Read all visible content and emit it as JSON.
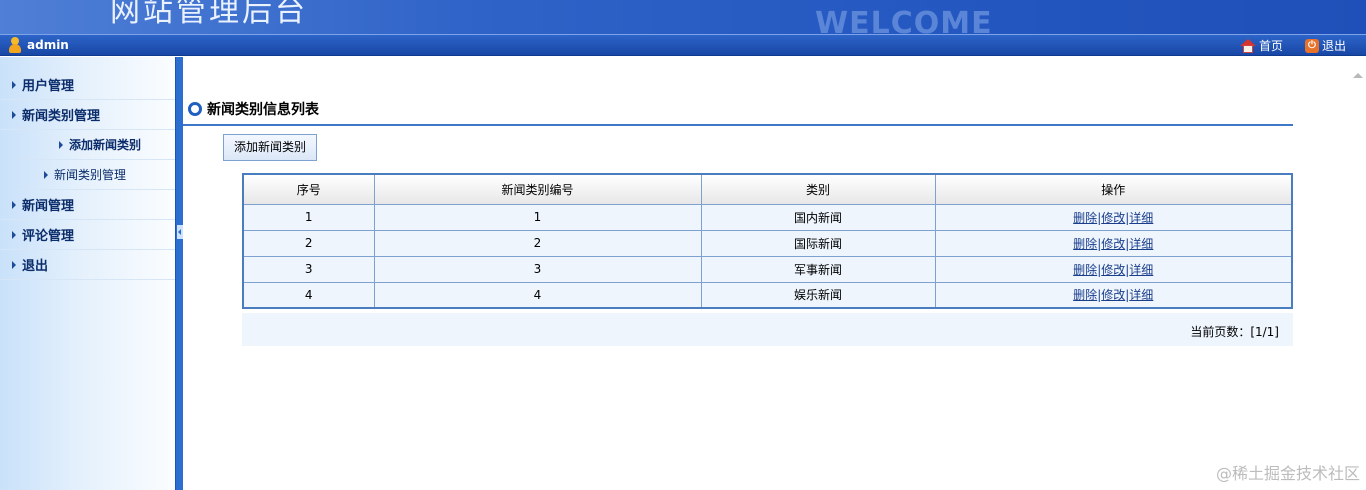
{
  "header": {
    "title": "网站管理后台",
    "welcome": "WELCOME"
  },
  "userbar": {
    "username": "admin",
    "home_label": "首页",
    "exit_label": "退出"
  },
  "sidebar": {
    "items": [
      {
        "label": "用户管理"
      },
      {
        "label": "新闻类别管理"
      },
      {
        "label": "添加新闻类别"
      },
      {
        "label": "新闻类别管理"
      },
      {
        "label": "新闻管理"
      },
      {
        "label": "评论管理"
      },
      {
        "label": "退出"
      }
    ]
  },
  "main": {
    "section_title": "新闻类别信息列表",
    "add_button": "添加新闻类别",
    "table": {
      "headers": [
        "序号",
        "新闻类别编号",
        "类别",
        "操作"
      ],
      "rows": [
        {
          "index": "1",
          "code": "1",
          "category": "国内新闻"
        },
        {
          "index": "2",
          "code": "2",
          "category": "国际新闻"
        },
        {
          "index": "3",
          "code": "3",
          "category": "军事新闻"
        },
        {
          "index": "4",
          "code": "4",
          "category": "娱乐新闻"
        }
      ],
      "actions": {
        "delete": "删除",
        "edit": "修改",
        "detail": "详细",
        "separator": "|"
      }
    },
    "pager": "当前页数：[1/1]"
  },
  "watermark": "@稀土掘金技术社区",
  "colors": {
    "banner": "#2f63c7",
    "userbar": "#1847a6",
    "accent": "#1f5fc0"
  }
}
